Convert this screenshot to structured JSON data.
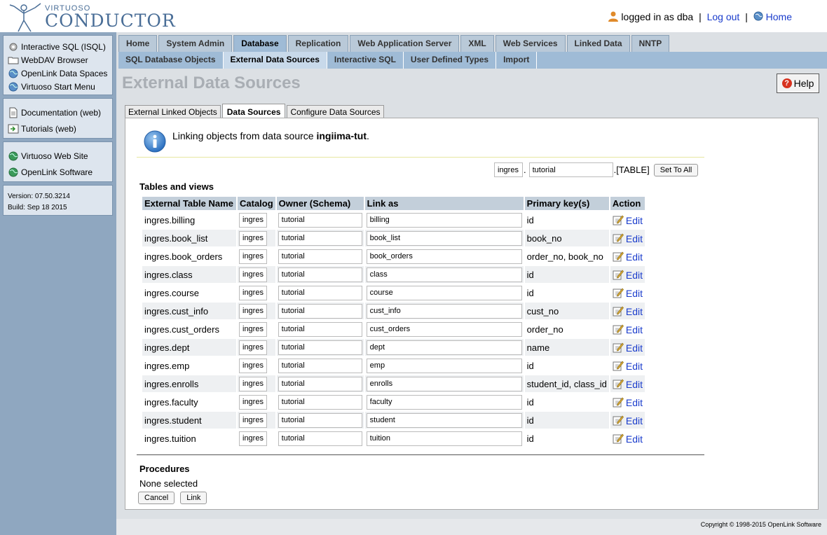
{
  "header": {
    "logo_sub": "VIRTUOSO",
    "logo_main": "CONDUCTOR",
    "logged_in_text": "logged in as dba",
    "logout_label": "Log out",
    "home_label": "Home"
  },
  "sidebar": {
    "group1": [
      {
        "label": "Interactive SQL (ISQL)",
        "icon": "gear-icon"
      },
      {
        "label": "WebDAV Browser",
        "icon": "folder-icon"
      },
      {
        "label": "OpenLink Data Spaces",
        "icon": "globe-icon"
      },
      {
        "label": "Virtuoso Start Menu",
        "icon": "globe-icon"
      }
    ],
    "group2": [
      {
        "label": "Documentation (web)",
        "icon": "document-icon"
      },
      {
        "label": "Tutorials (web)",
        "icon": "tutorial-icon"
      }
    ],
    "group3": [
      {
        "label": "Virtuoso Web Site",
        "icon": "globe-icon"
      },
      {
        "label": "OpenLink Software",
        "icon": "globe-icon"
      }
    ],
    "version": "Version: 07.50.3214",
    "build": "Build: Sep 18 2015"
  },
  "tabs_primary": [
    "Home",
    "System Admin",
    "Database",
    "Replication",
    "Web Application Server",
    "XML",
    "Web Services",
    "Linked Data",
    "NNTP"
  ],
  "tabs_secondary": [
    "SQL Database Objects",
    "External Data Sources",
    "Interactive SQL",
    "User Defined Types",
    "Import"
  ],
  "page_title": "External Data Sources",
  "help_label": "Help",
  "subtabs": [
    "External Linked Objects",
    "Data Sources",
    "Configure Data Sources"
  ],
  "info": {
    "message": "Linking objects from data source",
    "source_name": "ingiima-tut",
    "period": "."
  },
  "set_all": {
    "catalog": "ingres",
    "dot": ".",
    "owner": "tutorial",
    "suffix": ".[TABLE]",
    "button_label": "Set To All"
  },
  "tables_label": "Tables and views",
  "columns": [
    "External Table Name",
    "Catalog",
    "Owner (Schema)",
    "Link as",
    "Primary key(s)",
    "Action"
  ],
  "rows": [
    {
      "name": "ingres.billing",
      "catalog": "ingres",
      "owner": "tutorial",
      "link_as": "billing",
      "pk": "id"
    },
    {
      "name": "ingres.book_list",
      "catalog": "ingres",
      "owner": "tutorial",
      "link_as": "book_list",
      "pk": "book_no"
    },
    {
      "name": "ingres.book_orders",
      "catalog": "ingres",
      "owner": "tutorial",
      "link_as": "book_orders",
      "pk": "order_no, book_no"
    },
    {
      "name": "ingres.class",
      "catalog": "ingres",
      "owner": "tutorial",
      "link_as": "class",
      "pk": "id"
    },
    {
      "name": "ingres.course",
      "catalog": "ingres",
      "owner": "tutorial",
      "link_as": "course",
      "pk": "id"
    },
    {
      "name": "ingres.cust_info",
      "catalog": "ingres",
      "owner": "tutorial",
      "link_as": "cust_info",
      "pk": "cust_no"
    },
    {
      "name": "ingres.cust_orders",
      "catalog": "ingres",
      "owner": "tutorial",
      "link_as": "cust_orders",
      "pk": "order_no"
    },
    {
      "name": "ingres.dept",
      "catalog": "ingres",
      "owner": "tutorial",
      "link_as": "dept",
      "pk": "name"
    },
    {
      "name": "ingres.emp",
      "catalog": "ingres",
      "owner": "tutorial",
      "link_as": "emp",
      "pk": "id"
    },
    {
      "name": "ingres.enrolls",
      "catalog": "ingres",
      "owner": "tutorial",
      "link_as": "enrolls",
      "pk": "student_id, class_id"
    },
    {
      "name": "ingres.faculty",
      "catalog": "ingres",
      "owner": "tutorial",
      "link_as": "faculty",
      "pk": "id"
    },
    {
      "name": "ingres.student",
      "catalog": "ingres",
      "owner": "tutorial",
      "link_as": "student",
      "pk": "id"
    },
    {
      "name": "ingres.tuition",
      "catalog": "ingres",
      "owner": "tutorial",
      "link_as": "tuition",
      "pk": "id"
    }
  ],
  "edit_label": "Edit",
  "procedures": {
    "label": "Procedures",
    "none_text": "None selected",
    "cancel_label": "Cancel",
    "link_label": "Link"
  },
  "footer_text": "Copyright © 1998-2015 OpenLink Software"
}
